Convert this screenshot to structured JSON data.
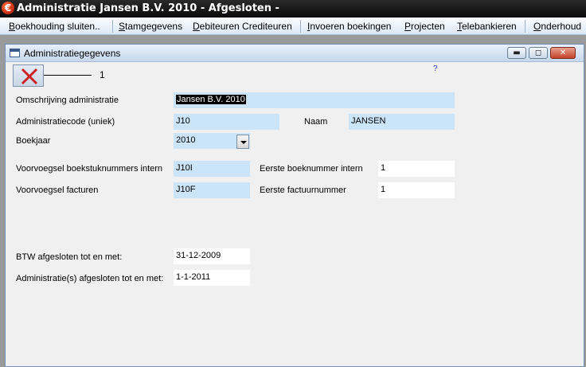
{
  "app": {
    "title": "Administratie Jansen B.V. 2010 - Afgesloten -",
    "icon": "euro-icon"
  },
  "menu": {
    "items": [
      {
        "label": "Boekhouding sluiten..",
        "accel": "B"
      },
      {
        "label": "Stamgegevens",
        "accel": "S"
      },
      {
        "label": "Debiteuren Crediteuren",
        "accel": "D"
      },
      {
        "label": "Invoeren boekingen",
        "accel": "I"
      },
      {
        "label": "Projecten",
        "accel": "P"
      },
      {
        "label": "Telebankieren",
        "accel": "T"
      },
      {
        "label": "Onderhoud",
        "accel": "O"
      }
    ]
  },
  "window": {
    "title": "Administratiegegevens",
    "controls": {
      "minimize": "▬",
      "restore": "◻",
      "close": "✕"
    },
    "help": "?",
    "toolbar": {
      "close_icon": "red-x-icon",
      "callout_number": "1"
    }
  },
  "form": {
    "omschrijving": {
      "label": "Omschrijving administratie",
      "value": "Jansen B.V. 2010"
    },
    "code": {
      "label": "Administratiecode (uniek)",
      "value": "J10"
    },
    "naam": {
      "label": "Naam",
      "value": "JANSEN"
    },
    "boekjaar": {
      "label": "Boekjaar",
      "value": "2010"
    },
    "voorvoegsel_boek": {
      "label": "Voorvoegsel boekstuknummers intern",
      "value": "J10I"
    },
    "eerste_boek": {
      "label": "Eerste  boeknummer intern",
      "value": "1"
    },
    "voorvoegsel_fact": {
      "label": "Voorvoegsel facturen",
      "value": "J10F"
    },
    "eerste_fact": {
      "label": "Eerste  factuurnummer",
      "value": "1"
    },
    "btw": {
      "label": "BTW afgesloten tot en met:",
      "value": "31-12-2009"
    },
    "adm_afgesloten": {
      "label": "Administratie(s) afgesloten tot en met:",
      "value": "1-1-2011"
    }
  }
}
